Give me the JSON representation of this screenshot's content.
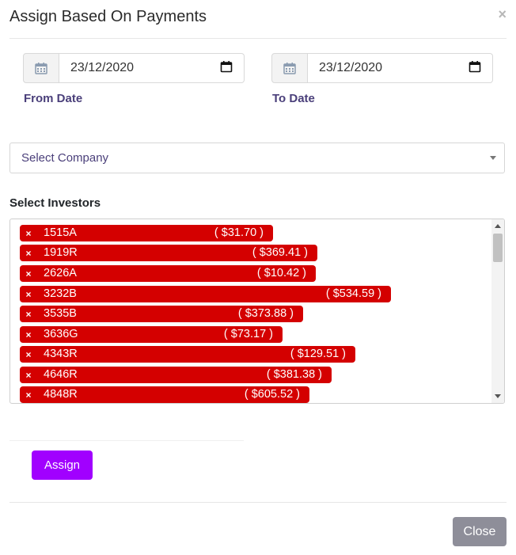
{
  "modal": {
    "title": "Assign Based On Payments",
    "close_symbol": "×"
  },
  "from_date": {
    "value": "23/12/2020",
    "label": "From Date"
  },
  "to_date": {
    "value": "23/12/2020",
    "label": "To Date"
  },
  "company_select": {
    "placeholder": "Select Company"
  },
  "investors": {
    "label": "Select Investors",
    "remove_symbol": "×",
    "items": [
      {
        "code": "1515A",
        "amount": "( $31.70 )"
      },
      {
        "code": "1919R",
        "amount": "( $369.41 )"
      },
      {
        "code": "2626A",
        "amount": "( $10.42 )"
      },
      {
        "code": "3232B",
        "amount": "( $534.59 )"
      },
      {
        "code": "3535B",
        "amount": "( $373.88 )"
      },
      {
        "code": "3636G",
        "amount": "( $73.17 )"
      },
      {
        "code": "4343R",
        "amount": "( $129.51 )"
      },
      {
        "code": "4646R",
        "amount": "( $381.38 )"
      },
      {
        "code": "4848R",
        "amount": "( $605.52 )"
      }
    ]
  },
  "buttons": {
    "assign": "Assign",
    "close": "Close"
  }
}
